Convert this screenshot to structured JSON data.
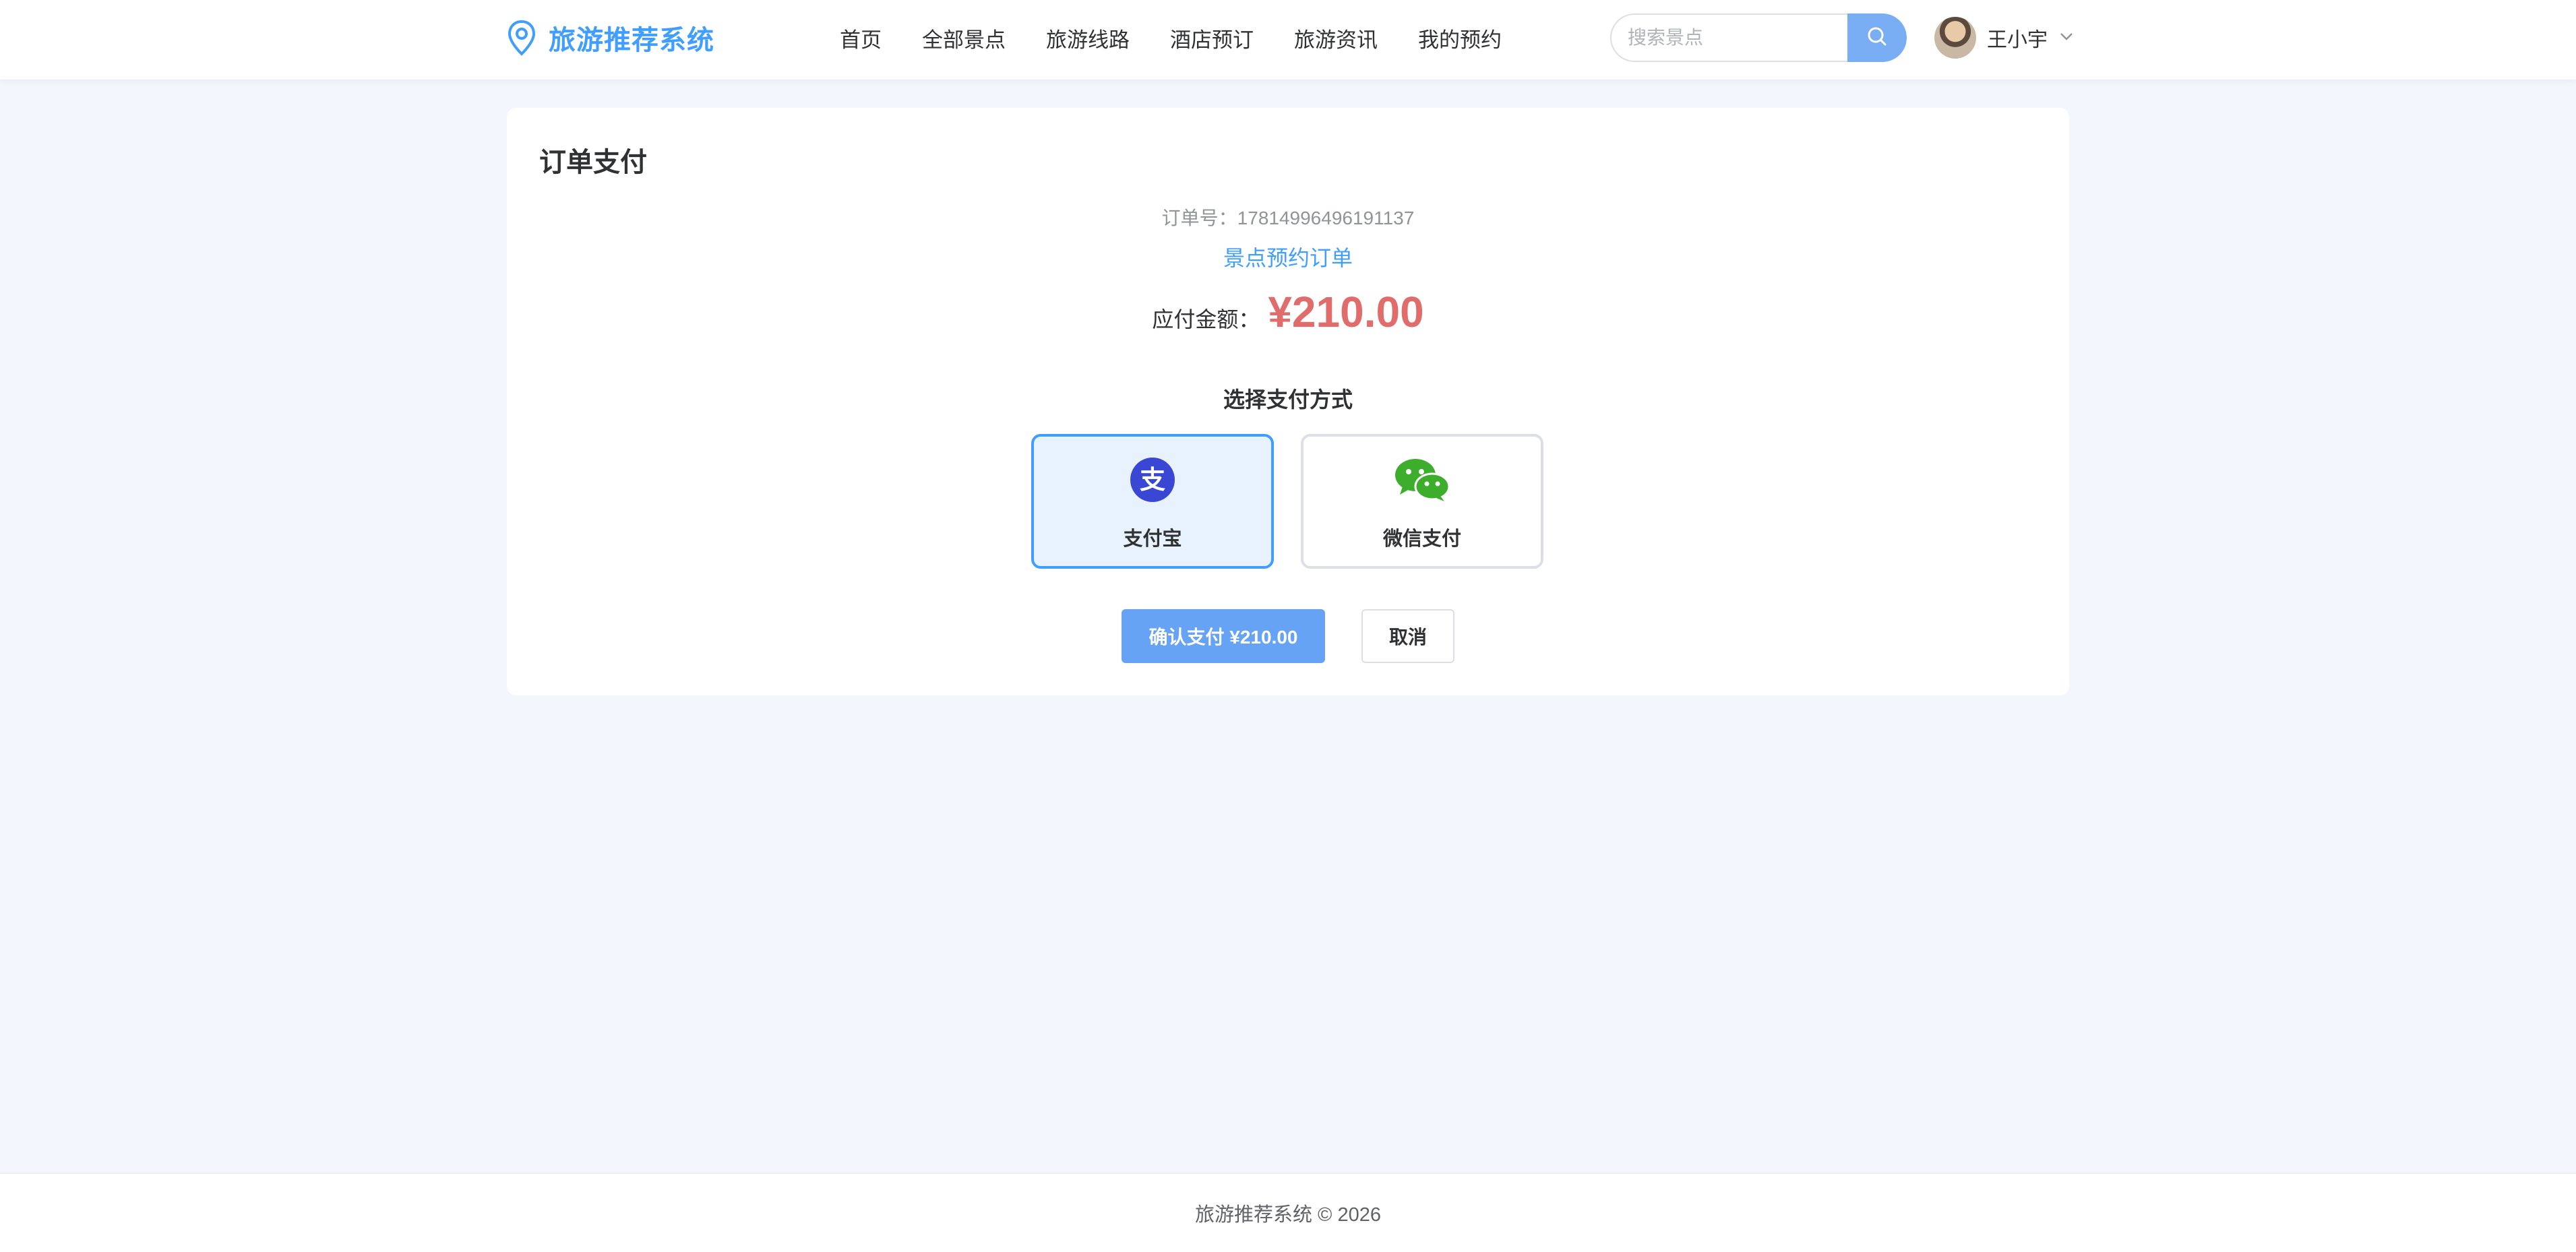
{
  "header": {
    "brand_title": "旅游推荐系统",
    "nav": [
      "首页",
      "全部景点",
      "旅游线路",
      "酒店预订",
      "旅游资讯",
      "我的预约"
    ],
    "search_placeholder": "搜索景点",
    "user_name": "王小宇"
  },
  "payment": {
    "title": "订单支付",
    "order_no": "订单号：17814996496191137",
    "order_type": "景点预约订单",
    "amount_label": "应付金额：",
    "amount_value": "¥210.00",
    "method_title": "选择支付方式",
    "methods": [
      {
        "label": "支付宝",
        "icon": "alipay-icon",
        "selected": true
      },
      {
        "label": "微信支付",
        "icon": "wechat-icon",
        "selected": false
      }
    ],
    "confirm_label": "确认支付 ¥210.00",
    "cancel_label": "取消"
  },
  "footer": {
    "text": "旅游推荐系统 © 2026"
  },
  "colors": {
    "accent": "#409eff",
    "price": "#e06c6c",
    "alipay": "#3a47d5",
    "wechat": "#3dae2b",
    "background": "#f3f7fd"
  }
}
